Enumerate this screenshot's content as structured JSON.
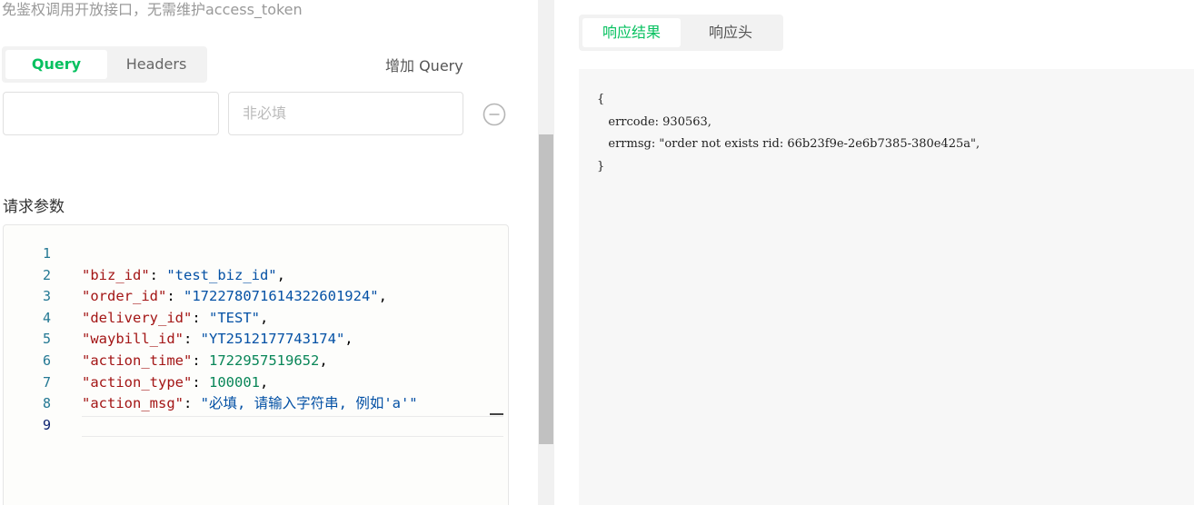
{
  "left": {
    "description": "免鉴权调用开放接口，无需维护access_token",
    "tabs": [
      {
        "label": "Query",
        "active": true
      },
      {
        "label": "Headers",
        "active": false
      }
    ],
    "add_query_label": "增加 Query",
    "query_row": {
      "key_value": "",
      "value_placeholder": "非必填"
    },
    "request_params_title": "请求参数",
    "editor": {
      "line_numbers": [
        "1",
        "2",
        "3",
        "4",
        "5",
        "6",
        "7",
        "8",
        "9"
      ],
      "lines": [
        {
          "key": "",
          "value": "",
          "sep": "",
          "end": ""
        },
        {
          "key": "\"biz_id\"",
          "sep": ": ",
          "value": "\"test_biz_id\"",
          "end": ","
        },
        {
          "key": "\"order_id\"",
          "sep": ": ",
          "value": "\"172278071614322601924\"",
          "end": ","
        },
        {
          "key": "\"delivery_id\"",
          "sep": ": ",
          "value": "\"TEST\"",
          "end": ","
        },
        {
          "key": "\"waybill_id\"",
          "sep": ": ",
          "value": "\"YT2512177743174\"",
          "end": ","
        },
        {
          "key": "\"action_time\"",
          "sep": ": ",
          "value": "1722957519652",
          "end": ","
        },
        {
          "key": "\"action_type\"",
          "sep": ": ",
          "value": "100001",
          "end": ","
        },
        {
          "key": "\"action_msg\"",
          "sep": ": ",
          "value": "\"必填, 请输入字符串, 例如'a'\"",
          "end": ""
        },
        {
          "key": "",
          "value": "",
          "sep": "",
          "end": ""
        }
      ]
    }
  },
  "right": {
    "tabs": [
      {
        "label": "响应结果",
        "active": true
      },
      {
        "label": "响应头",
        "active": false
      }
    ],
    "result_lines": [
      "{",
      "   errcode: 930563,",
      "   errmsg: \"order not exists rid: 66b23f9e-2e6b7385-380e425a\",",
      "}"
    ]
  },
  "colors": {
    "accent": "#07c160",
    "json_key": "#a31515",
    "json_string": "#0451a5",
    "json_number": "#098658",
    "line_number": "#237893"
  }
}
